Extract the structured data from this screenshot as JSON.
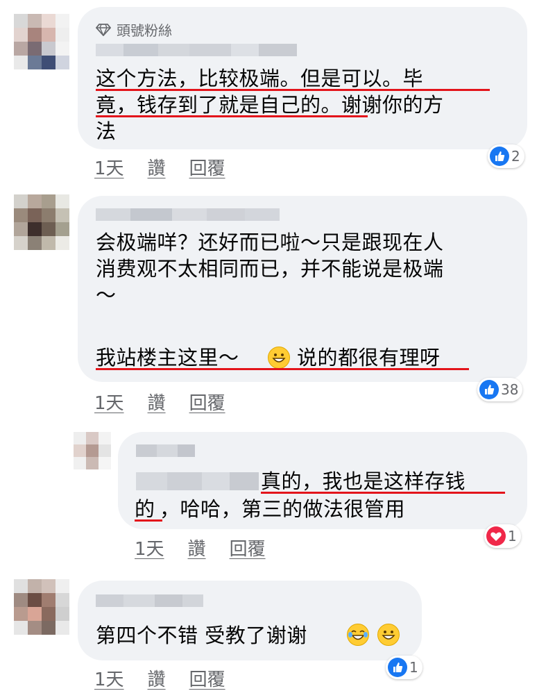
{
  "comments": [
    {
      "badge": "頭號粉絲",
      "lines": [
        "这个方法，比较极端。但是可以。毕",
        "竟，钱存到了就是自己的。谢谢你的方",
        "法"
      ],
      "actions": {
        "time": "1天",
        "like": "讚",
        "reply": "回覆"
      },
      "reaction": {
        "type": "like",
        "count": "2"
      }
    },
    {
      "lines": [
        "会极端咩？还好而已啦～只是跟现在人",
        "消费观不太相同而已，并不能说是极端",
        "～",
        ""
      ],
      "last_line_a": "我站楼主这里～",
      "last_line_b": "说的都很有理呀",
      "actions": {
        "time": "1天",
        "like": "讚",
        "reply": "回覆"
      },
      "reaction": {
        "type": "like",
        "count": "38"
      }
    },
    {
      "line1": "真的，我也是这样存钱",
      "line2a": "的",
      "line2b": "，哈哈，第三的做法很管用",
      "actions": {
        "time": "1天",
        "like": "讚",
        "reply": "回覆"
      },
      "reaction": {
        "type": "love",
        "count": "1"
      }
    },
    {
      "line": "第四个不错 受教了谢谢",
      "actions": {
        "time": "1天",
        "like": "讚",
        "reply": "回覆"
      },
      "reaction": {
        "type": "like",
        "count": "1"
      }
    }
  ],
  "colors": {
    "bubble": "#f0f2f5",
    "underline": "#e3141b",
    "like": "#1877f2",
    "love": "#f02849"
  },
  "icons": [
    "diamond-icon",
    "like-icon",
    "love-icon",
    "grin-emoji",
    "tears-of-joy-emoji"
  ]
}
